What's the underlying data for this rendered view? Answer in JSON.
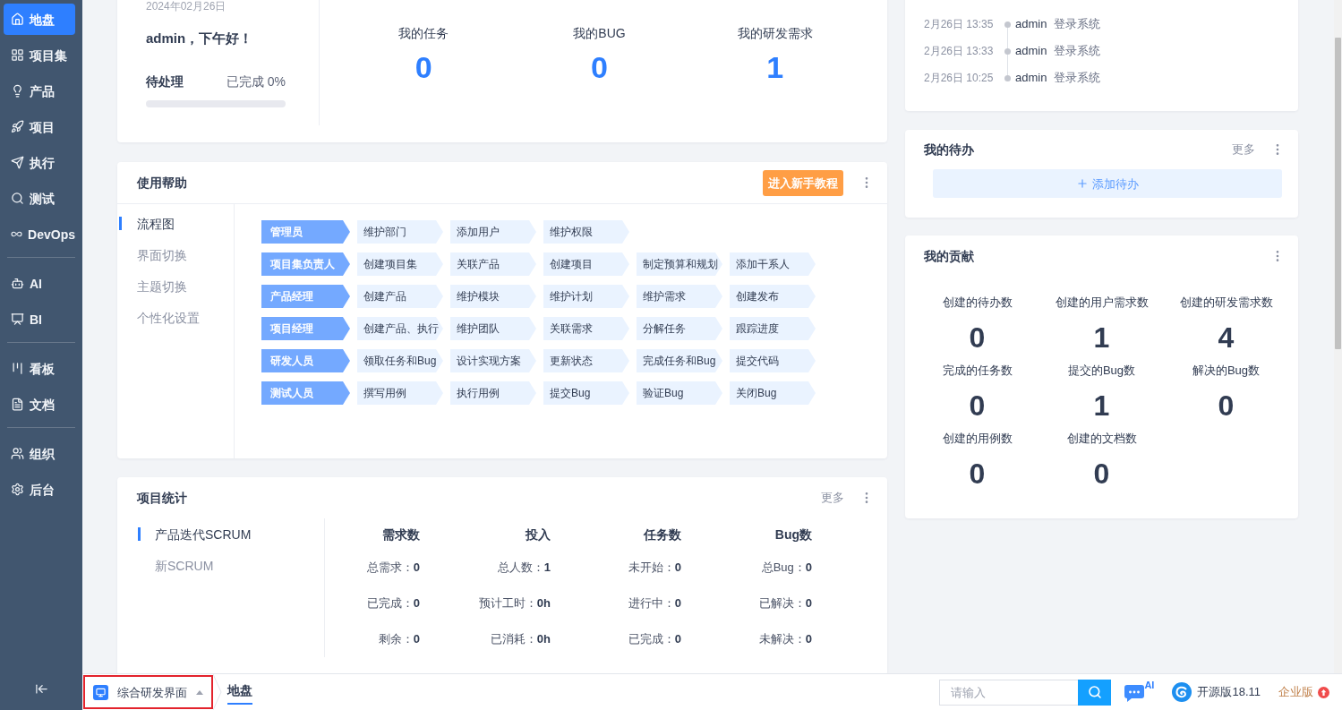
{
  "sidebar": {
    "groups": [
      {
        "items": [
          {
            "label": "地盘",
            "selected": true
          },
          {
            "label": "项目集",
            "selected": false
          },
          {
            "label": "产品",
            "selected": false
          },
          {
            "label": "项目",
            "selected": false
          },
          {
            "label": "执行",
            "selected": false
          },
          {
            "label": "测试",
            "selected": false
          },
          {
            "label": "DevOps",
            "selected": false
          }
        ]
      },
      {
        "items": [
          {
            "label": "AI",
            "selected": false
          },
          {
            "label": "BI",
            "selected": false
          }
        ]
      },
      {
        "items": [
          {
            "label": "看板",
            "selected": false
          },
          {
            "label": "文档",
            "selected": false
          }
        ]
      },
      {
        "items": [
          {
            "label": "组织",
            "selected": false
          },
          {
            "label": "后台",
            "selected": false
          }
        ]
      }
    ]
  },
  "welcome": {
    "date": "2024年02月26日",
    "greeting": "admin，下午好！",
    "pending_label": "待处理",
    "done_label": "已完成 0%",
    "progress": {
      "level": 0
    }
  },
  "work_summary": {
    "stats": [
      {
        "label": "我的任务",
        "value": "0"
      },
      {
        "label": "我的BUG",
        "value": "0"
      },
      {
        "label": "我的研发需求",
        "value": "1"
      }
    ]
  },
  "help": {
    "title": "使用帮助",
    "tutorial_button": "进入新手教程",
    "tabs": [
      {
        "label": "流程图",
        "selected": true
      },
      {
        "label": "界面切换",
        "selected": false
      },
      {
        "label": "主题切换",
        "selected": false
      },
      {
        "label": "个性化设置",
        "selected": false
      }
    ],
    "flow": [
      {
        "role": "管理员",
        "steps": [
          "维护部门",
          "添加用户",
          "维护权限"
        ]
      },
      {
        "role": "项目集负责人",
        "steps": [
          "创建项目集",
          "关联产品",
          "创建项目",
          "制定预算和规划",
          "添加干系人"
        ]
      },
      {
        "role": "产品经理",
        "steps": [
          "创建产品",
          "维护模块",
          "维护计划",
          "维护需求",
          "创建发布"
        ]
      },
      {
        "role": "项目经理",
        "steps": [
          "创建产品、执行",
          "维护团队",
          "关联需求",
          "分解任务",
          "跟踪进度"
        ]
      },
      {
        "role": "研发人员",
        "steps": [
          "领取任务和Bug",
          "设计实现方案",
          "更新状态",
          "完成任务和Bug",
          "提交代码"
        ]
      },
      {
        "role": "测试人员",
        "steps": [
          "撰写用例",
          "执行用例",
          "提交Bug",
          "验证Bug",
          "关闭Bug"
        ]
      }
    ]
  },
  "project_stats": {
    "title": "项目统计",
    "more": "更多",
    "projects": [
      {
        "label": "产品迭代SCRUM",
        "selected": true
      },
      {
        "label": "新SCRUM",
        "selected": false
      }
    ],
    "columns": [
      {
        "heading": "需求数",
        "rows": [
          "总需求：**0**",
          "已完成：**0**",
          "剩余：**0**"
        ]
      },
      {
        "heading": "投入",
        "rows": [
          "总人数：**1**",
          "预计工时：**0h**",
          "已消耗：**0h**"
        ]
      },
      {
        "heading": "任务数",
        "rows": [
          "未开始：**0**",
          "进行中：**0**",
          "已完成：**0**"
        ]
      },
      {
        "heading": "Bug数",
        "rows": [
          "总Bug：**0**",
          "已解决：**0**",
          "未解决：**0**"
        ]
      }
    ]
  },
  "activity": {
    "entries": [
      {
        "time": "2月26日 13:35",
        "user": "admin",
        "action": "登录系统"
      },
      {
        "time": "2月26日 13:33",
        "user": "admin",
        "action": "登录系统"
      },
      {
        "time": "2月26日 10:25",
        "user": "admin",
        "action": "登录系统"
      }
    ]
  },
  "todo": {
    "title": "我的待办",
    "more": "更多",
    "add_button": "添加待办"
  },
  "contribution": {
    "title": "我的贡献",
    "stats": [
      {
        "label": "创建的待办数",
        "value": "0"
      },
      {
        "label": "创建的用户需求数",
        "value": "1"
      },
      {
        "label": "创建的研发需求数",
        "value": "4"
      },
      {
        "label": "完成的任务数",
        "value": "0"
      },
      {
        "label": "提交的Bug数",
        "value": "1"
      },
      {
        "label": "解决的Bug数",
        "value": "0"
      },
      {
        "label": "创建的用例数",
        "value": "0"
      },
      {
        "label": "创建的文档数",
        "value": "0"
      }
    ]
  },
  "bottom_bar": {
    "switcher": {
      "label": "综合研发界面",
      "highlighted": true
    },
    "tabs": [
      {
        "label": "地盘",
        "selected": true
      }
    ],
    "search": {
      "placeholder": "请输入"
    },
    "ai_badge": "AI",
    "version": "开源版18.11",
    "upgrade": "企业版"
  }
}
